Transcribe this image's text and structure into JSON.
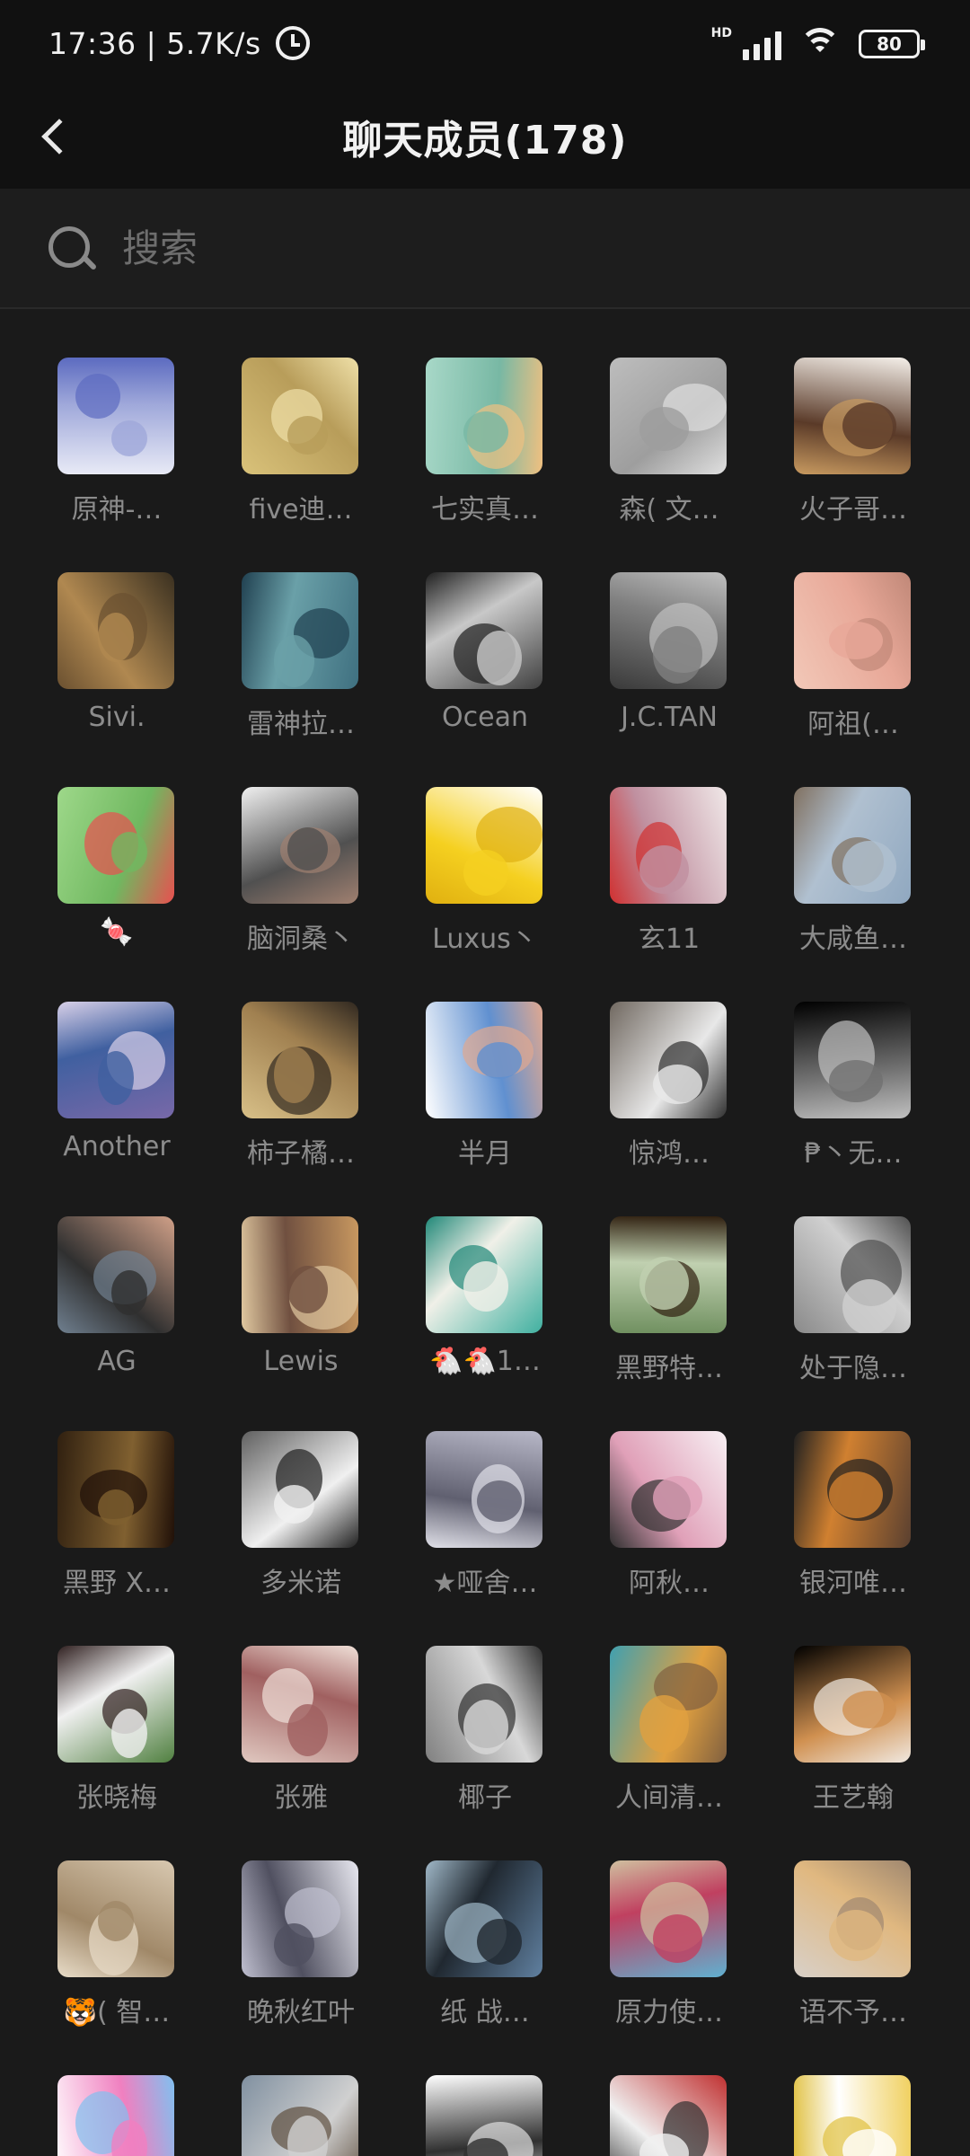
{
  "status_bar": {
    "time": "17:36 | 5.7K/s",
    "network_type": "HD",
    "battery": "80",
    "icons": [
      "alarm-icon",
      "signal-icon",
      "wifi-icon",
      "battery-icon"
    ]
  },
  "header": {
    "title": "聊天成员(178)",
    "back_icon": "chevron-left-icon"
  },
  "search": {
    "placeholder": "搜索",
    "icon": "search-icon"
  },
  "members": [
    {
      "name": "原神-…",
      "colors": [
        "#e8eaf6",
        "#9fa8da",
        "#5c6bc0"
      ]
    },
    {
      "name": "five迪…",
      "colors": [
        "#d9c27a",
        "#b89d5a",
        "#efe0a8"
      ]
    },
    {
      "name": "七实真…",
      "colors": [
        "#a8d8c8",
        "#78b8a4",
        "#f0c080"
      ]
    },
    {
      "name": "森( 文…",
      "colors": [
        "#bdbdbd",
        "#9e9e9e",
        "#e0e0e0"
      ]
    },
    {
      "name": "火子哥…",
      "colors": [
        "#f5f0ea",
        "#5a3a28",
        "#c89a60"
      ]
    },
    {
      "name": "Sivi.",
      "colors": [
        "#3a3020",
        "#b08850",
        "#6a5030"
      ]
    },
    {
      "name": "雷神拉…",
      "colors": [
        "#3f7080",
        "#6aa0a8",
        "#204050"
      ]
    },
    {
      "name": "Ocean",
      "colors": [
        "#404040",
        "#c8c8c8",
        "#202020"
      ]
    },
    {
      "name": "J.C.TAN",
      "colors": [
        "#3a3a3a",
        "#808080",
        "#c0c0c0"
      ]
    },
    {
      "name": "阿祖(…",
      "colors": [
        "#f2c8b8",
        "#e8a898",
        "#c08878"
      ]
    },
    {
      "name": "🍬",
      "colors": [
        "#9ed88a",
        "#70b860",
        "#e85050"
      ]
    },
    {
      "name": "脑洞桑丶",
      "colors": [
        "#f0f0f0",
        "#505050",
        "#a08070"
      ]
    },
    {
      "name": "Luxus丶",
      "colors": [
        "#ffffff",
        "#f5d020",
        "#e0b010"
      ]
    },
    {
      "name": "玄11",
      "colors": [
        "#f0e8e8",
        "#c090a0",
        "#d03030"
      ]
    },
    {
      "name": "大咸鱼…",
      "colors": [
        "#90a8c0",
        "#b0c0d0",
        "#807060"
      ]
    },
    {
      "name": "Another",
      "colors": [
        "#7868a8",
        "#4060a0",
        "#d8d0e8"
      ]
    },
    {
      "name": "柿子橘…",
      "colors": [
        "#d8c088",
        "#a08050",
        "#302820"
      ]
    },
    {
      "name": "半月",
      "colors": [
        "#ffffff",
        "#6090d0",
        "#e0a890"
      ]
    },
    {
      "name": "惊鸿…",
      "colors": [
        "#706860",
        "#e8e8e8",
        "#303030"
      ]
    },
    {
      "name": "₱丶无…",
      "colors": [
        "#000000",
        "#707070",
        "#c0c0c0"
      ]
    },
    {
      "name": "AG",
      "colors": [
        "#d0a088",
        "#303030",
        "#708090"
      ]
    },
    {
      "name": "Lewis",
      "colors": [
        "#c89860",
        "#705040",
        "#e0c8a0"
      ]
    },
    {
      "name": "🐔🐔1…",
      "colors": [
        "#40b0a0",
        "#f0f0e8",
        "#208878"
      ]
    },
    {
      "name": "黑野特…",
      "colors": [
        "#709060",
        "#c0d0b0",
        "#302010"
      ]
    },
    {
      "name": "处于隐…",
      "colors": [
        "#8a8a8a",
        "#d0d0d0",
        "#505050"
      ]
    },
    {
      "name": "黑野 X…",
      "colors": [
        "#302010",
        "#806030",
        "#201008"
      ]
    },
    {
      "name": "多米诺",
      "colors": [
        "#606060",
        "#f0f0f0",
        "#202020"
      ]
    },
    {
      "name": "★哑舍…",
      "colors": [
        "#b8b8c8",
        "#606070",
        "#e0e0e8"
      ]
    },
    {
      "name": "阿秋…",
      "colors": [
        "#f8f0f4",
        "#e0a0b8",
        "#303030"
      ]
    },
    {
      "name": "银河唯…",
      "colors": [
        "#5a4030",
        "#d08030",
        "#202020"
      ]
    },
    {
      "name": "张晓梅",
      "colors": [
        "#508040",
        "#f0f0f0",
        "#302020"
      ]
    },
    {
      "name": "张雅",
      "colors": [
        "#e0c8c0",
        "#a06060",
        "#f0e0d8"
      ]
    },
    {
      "name": "椰子",
      "colors": [
        "#808080",
        "#d8d8d8",
        "#303030"
      ]
    },
    {
      "name": "人间清…",
      "colors": [
        "#40a0b0",
        "#e0a040",
        "#806040"
      ]
    },
    {
      "name": "王艺翰",
      "colors": [
        "#000000",
        "#d09050",
        "#f0e8e0"
      ]
    },
    {
      "name": "🐯( 智…",
      "colors": [
        "#d8c8b0",
        "#a08868",
        "#e8dcc8"
      ]
    },
    {
      "name": "晚秋红叶",
      "colors": [
        "#e8e8f0",
        "#505060",
        "#c0c0d0"
      ]
    },
    {
      "name": "纸  战…",
      "colors": [
        "#6080a0",
        "#202830",
        "#a0b8c8"
      ]
    },
    {
      "name": "原力使…",
      "colors": [
        "#60b0d0",
        "#c04060",
        "#d0c0a0"
      ]
    },
    {
      "name": "语不予…",
      "colors": [
        "#d8d0c8",
        "#e0b880",
        "#a08870"
      ]
    },
    {
      "name": "",
      "colors": [
        "#ffffff",
        "#f080c0",
        "#80c0f0"
      ]
    },
    {
      "name": "",
      "colors": [
        "#8090a0",
        "#d0d0d0",
        "#605040"
      ]
    },
    {
      "name": "",
      "colors": [
        "#ffffff",
        "#303030",
        "#e0e0e0"
      ]
    },
    {
      "name": "",
      "colors": [
        "#c03030",
        "#f0f0f0",
        "#303030"
      ]
    },
    {
      "name": "",
      "colors": [
        "#f0d060",
        "#ffffff",
        "#e0c040"
      ]
    }
  ]
}
